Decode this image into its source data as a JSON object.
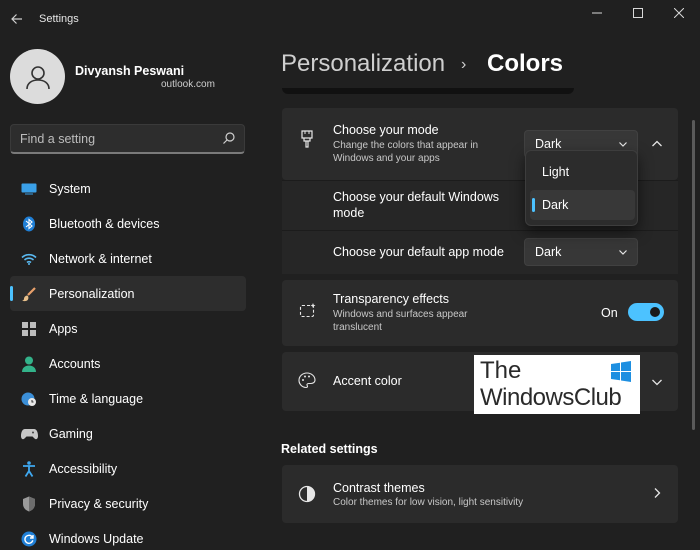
{
  "window": {
    "title": "Settings",
    "controls": [
      "minimize",
      "maximize",
      "close"
    ]
  },
  "profile": {
    "name": "Divyansh Peswani",
    "email": "outlook.com"
  },
  "search": {
    "placeholder": "Find a setting"
  },
  "sidebar": {
    "items": [
      {
        "label": "System",
        "icon": "system-icon",
        "selected": false
      },
      {
        "label": "Bluetooth & devices",
        "icon": "bluetooth-icon",
        "selected": false
      },
      {
        "label": "Network & internet",
        "icon": "wifi-icon",
        "selected": false
      },
      {
        "label": "Personalization",
        "icon": "brush-icon",
        "selected": true
      },
      {
        "label": "Apps",
        "icon": "apps-icon",
        "selected": false
      },
      {
        "label": "Accounts",
        "icon": "accounts-icon",
        "selected": false
      },
      {
        "label": "Time & language",
        "icon": "globe-clock-icon",
        "selected": false
      },
      {
        "label": "Gaming",
        "icon": "gamepad-icon",
        "selected": false
      },
      {
        "label": "Accessibility",
        "icon": "accessibility-icon",
        "selected": false
      },
      {
        "label": "Privacy & security",
        "icon": "shield-icon",
        "selected": false
      },
      {
        "label": "Windows Update",
        "icon": "update-icon",
        "selected": false
      }
    ]
  },
  "header": {
    "parent": "Personalization",
    "separator": "›",
    "current": "Colors"
  },
  "mode": {
    "title": "Choose your mode",
    "description": "Change the colors that appear in Windows and your apps",
    "value": "Dark",
    "popup_options": [
      "Light",
      "Dark"
    ],
    "popup_selected": "Dark",
    "windows_mode_label": "Choose your default Windows mode",
    "app_mode_label": "Choose your default app mode",
    "app_mode_value": "Dark"
  },
  "transparency": {
    "title": "Transparency effects",
    "description": "Windows and surfaces appear translucent",
    "state_label": "On",
    "enabled": true
  },
  "accent": {
    "title": "Accent color"
  },
  "related": {
    "heading": "Related settings",
    "contrast_title": "Contrast themes",
    "contrast_description": "Color themes for low vision, light sensitivity"
  },
  "watermark": {
    "line1": "The",
    "line2": "WindowsClub"
  },
  "colors": {
    "accent": "#4cc2ff",
    "background": "#202020",
    "card": "#2b2b2b"
  }
}
